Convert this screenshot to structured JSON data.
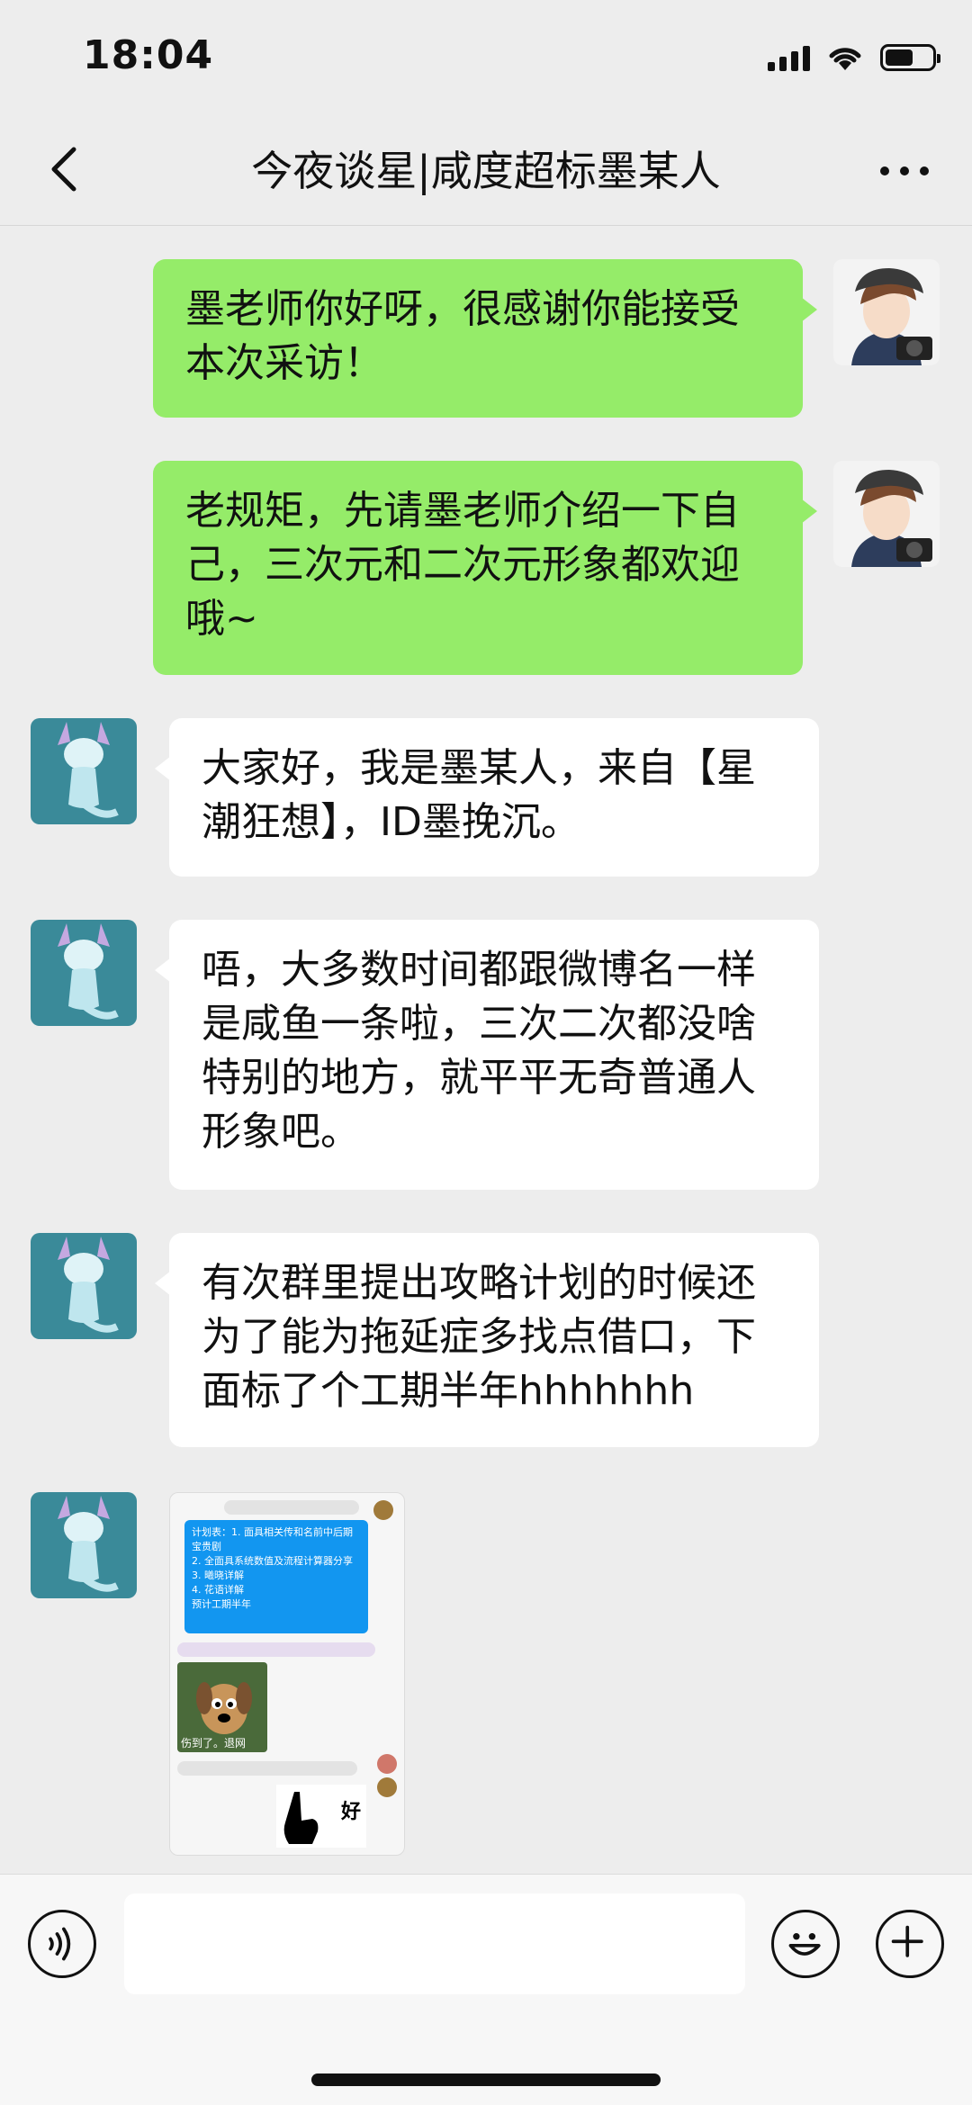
{
  "status_bar": {
    "time": "18:04",
    "signal_icon": "cellular-signal-icon",
    "wifi_icon": "wifi-icon",
    "battery_icon": "battery-icon",
    "battery_level": 0.6
  },
  "header": {
    "back_icon": "chevron-left-icon",
    "title": "今夜谈星|咸度超标墨某人",
    "more_icon": "more-dots-icon"
  },
  "messages": [
    {
      "side": "right",
      "sender": "interviewer",
      "text": "墨老师你好呀，很感谢你能接受本次采访！"
    },
    {
      "side": "right",
      "sender": "interviewer",
      "text": "老规矩，先请墨老师介绍一下自己，三次元和二次元形象都欢迎哦~"
    },
    {
      "side": "left",
      "sender": "guest",
      "text": "大家好，我是墨某人，来自【星潮狂想】，ID墨挽沉。"
    },
    {
      "side": "left",
      "sender": "guest",
      "text": "唔，大多数时间都跟微博名一样是咸鱼一条啦，三次二次都没啥特别的地方，就平平无奇普通人形象吧。"
    },
    {
      "side": "left",
      "sender": "guest",
      "text": "有次群里提出攻略计划的时候还为了能为拖延症多找点借口，下面标了个工期半年hhhhhhh"
    }
  ],
  "image_message": {
    "note_lines": [
      "计划表：1. 面具相关传和名前中后期宝贵剧",
      "2. 全面具系统数值及流程计算器分享",
      "3. 曦晓详解",
      "4. 花语详解",
      "预计工期半年"
    ],
    "sticker_caption": "伤到了。退网",
    "hand_sticker_label": "好"
  },
  "input_bar": {
    "voice_icon": "voice-icon",
    "input_value": "",
    "emoji_icon": "emoji-icon",
    "plus_icon": "plus-icon"
  },
  "colors": {
    "background": "#ededed",
    "sent_bubble": "#95ec69",
    "received_bubble": "#ffffff",
    "note_blue": "#1296f0"
  }
}
